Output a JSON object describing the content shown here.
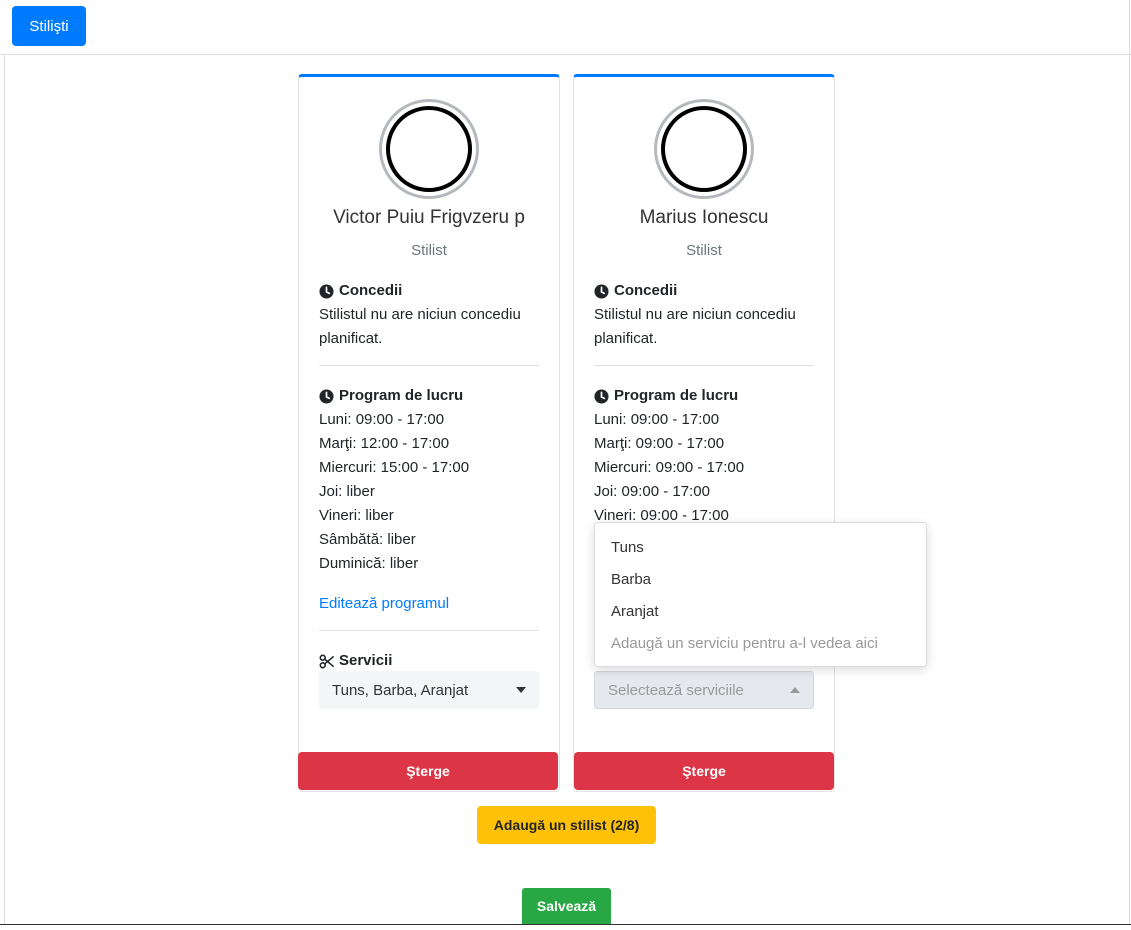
{
  "topbar": {
    "button_label": "Stilişti"
  },
  "labels": {
    "leave_title": "Concedii",
    "schedule_title": "Program de lucru",
    "services_title": "Servicii",
    "delete": "Şterge"
  },
  "stylists": [
    {
      "name": "Victor Puiu Frigvzeru p",
      "role": "Stilist",
      "leave_text": "Stilistul nu are niciun concediu planificat.",
      "schedule": [
        "Luni: 09:00 - 17:00",
        "Marţi: 12:00 - 17:00",
        "Miercuri: 15:00 - 17:00",
        "Joi: liber",
        "Vineri: liber",
        "Sâmbătă: liber",
        "Duminică: liber"
      ],
      "edit_link": "Editează programul",
      "services_value": "Tuns, Barba, Aranjat"
    },
    {
      "name": "Marius Ionescu",
      "role": "Stilist",
      "leave_text": "Stilistul nu are niciun concediu planificat.",
      "schedule": [
        "Luni: 09:00 - 17:00",
        "Marţi: 09:00 - 17:00",
        "Miercuri: 09:00 - 17:00",
        "Joi: 09:00 - 17:00",
        "Vineri: 09:00 - 17:00"
      ],
      "services_placeholder": "Selectează serviciile"
    }
  ],
  "dropdown": {
    "options": [
      "Tuns",
      "Barba",
      "Aranjat"
    ],
    "hint": "Adaugă un serviciu pentru a-l vedea aici"
  },
  "actions": {
    "add_stylist": "Adaugă un stilist (2/8)",
    "save": "Salvează"
  },
  "colors": {
    "primary": "#007bff",
    "danger": "#dc3545",
    "warning": "#ffc107",
    "success": "#28a745"
  }
}
